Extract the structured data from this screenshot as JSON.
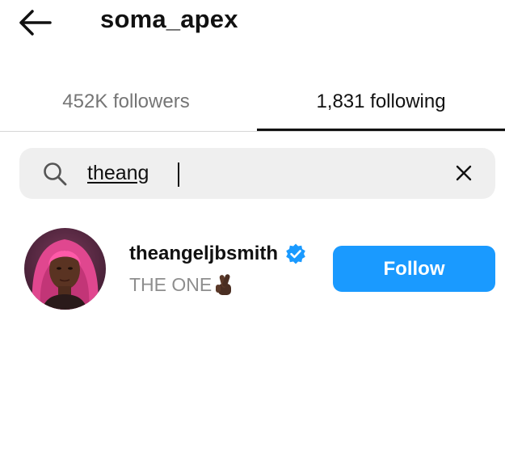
{
  "header": {
    "title": "soma_apex",
    "back_icon": "arrow-left-icon"
  },
  "tabs": [
    {
      "label": "452K followers",
      "active": false
    },
    {
      "label": "1,831 following",
      "active": true
    }
  ],
  "search": {
    "value": "theang",
    "search_icon": "search-icon",
    "clear_icon": "close-icon"
  },
  "results": [
    {
      "username": "theangeljbsmith",
      "verified": true,
      "subtitle": "THE ONE",
      "subtitle_emoji": "crossed-fingers-icon",
      "button_label": "Follow"
    }
  ],
  "colors": {
    "accent": "#1a9aff",
    "muted_text": "#8e8e8e",
    "search_bg": "#efefef"
  }
}
